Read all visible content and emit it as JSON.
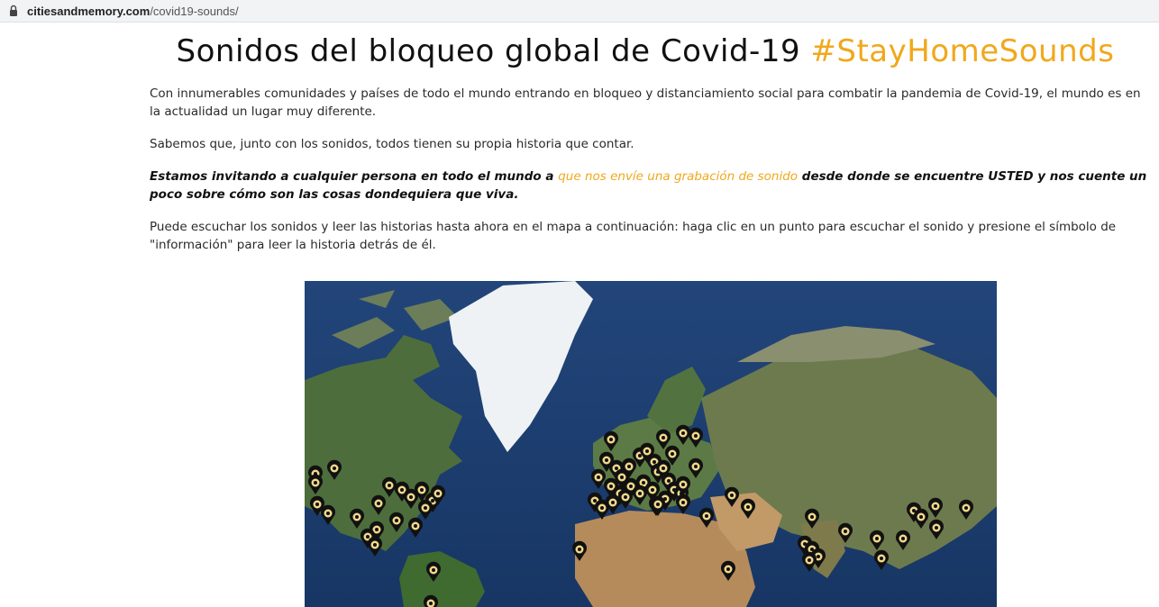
{
  "browser": {
    "url_host": "citiesandmemory.com",
    "url_path": "/covid19-sounds/"
  },
  "page": {
    "title_main": "Sonidos del bloqueo global de Covid-19 ",
    "title_tag": "#StayHomeSounds",
    "paragraph1": "Con innumerables comunidades y países de todo el mundo entrando en bloqueo y distanciamiento social para combatir la pandemia de Covid-19, el mundo es en la actualidad un lugar muy diferente.",
    "paragraph2": "Sabemos que, junto con los sonidos, todos tienen su propia historia que contar.",
    "paragraph3_before": "Estamos invitando a cualquier persona en todo el mundo a ",
    "paragraph3_link": "que nos envíe una grabación de sonido",
    "paragraph3_after": " desde donde se encuentre USTED y nos cuente un poco sobre cómo son las cosas dondequiera que viva.",
    "paragraph4": "Puede escuchar los sonidos y leer las historias hasta ahora en el mapa a continuación: haga clic en un punto para escuchar el sonido y presione el símbolo de \"información\" para leer la historia detrás de él."
  },
  "map": {
    "marker_icon": "map-pin-icon",
    "marker_color": "#f2d98a",
    "ocean_color": "#1b3a66",
    "land_color": "#4a6b3a"
  }
}
